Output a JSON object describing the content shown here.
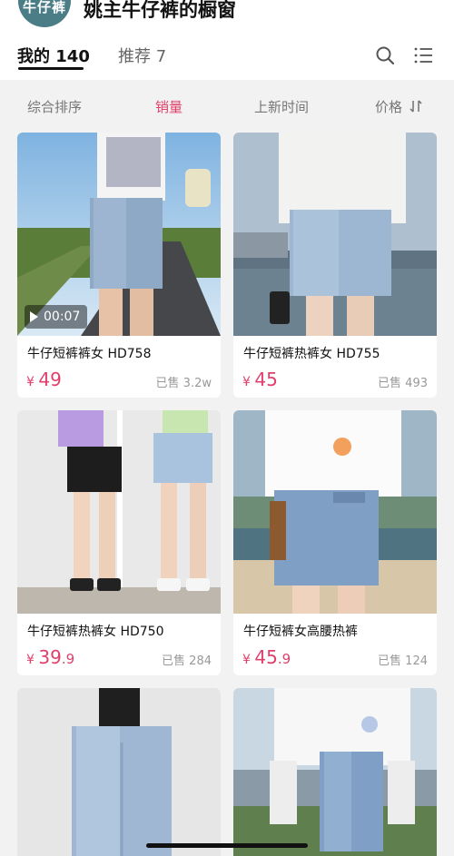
{
  "shop": {
    "avatar_text": "牛仔裤",
    "title": "姚主牛仔裤的橱窗"
  },
  "tabs": {
    "mine": "我的 140",
    "recommend": "推荐 7"
  },
  "icons": {
    "search": "search-icon",
    "list": "list-icon"
  },
  "sort": {
    "overall": "综合排序",
    "sales": "销量",
    "newest": "上新时间",
    "price": "价格"
  },
  "colors": {
    "accent": "#e0406b",
    "avatar_bg": "#4b7d86"
  },
  "products": [
    {
      "name": "牛仔短裤裤女 HD758",
      "currency": "¥",
      "price_int": "49",
      "price_dec": "",
      "sold": "已售 3.2w",
      "video": "00:07"
    },
    {
      "name": "牛仔短裤热裤女 HD755",
      "currency": "¥",
      "price_int": "45",
      "price_dec": "",
      "sold": "已售 493"
    },
    {
      "name": "牛仔短裤热裤女 HD750",
      "currency": "¥",
      "price_int": "39",
      "price_dec": ".9",
      "sold": "已售 284"
    },
    {
      "name": "牛仔短裤女高腰热裤",
      "currency": "¥",
      "price_int": "45",
      "price_dec": ".9",
      "sold": "已售 124"
    },
    {
      "name": "",
      "currency": "",
      "price_int": "",
      "price_dec": "",
      "sold": ""
    },
    {
      "name": "",
      "currency": "",
      "price_int": "",
      "price_dec": "",
      "sold": ""
    }
  ]
}
